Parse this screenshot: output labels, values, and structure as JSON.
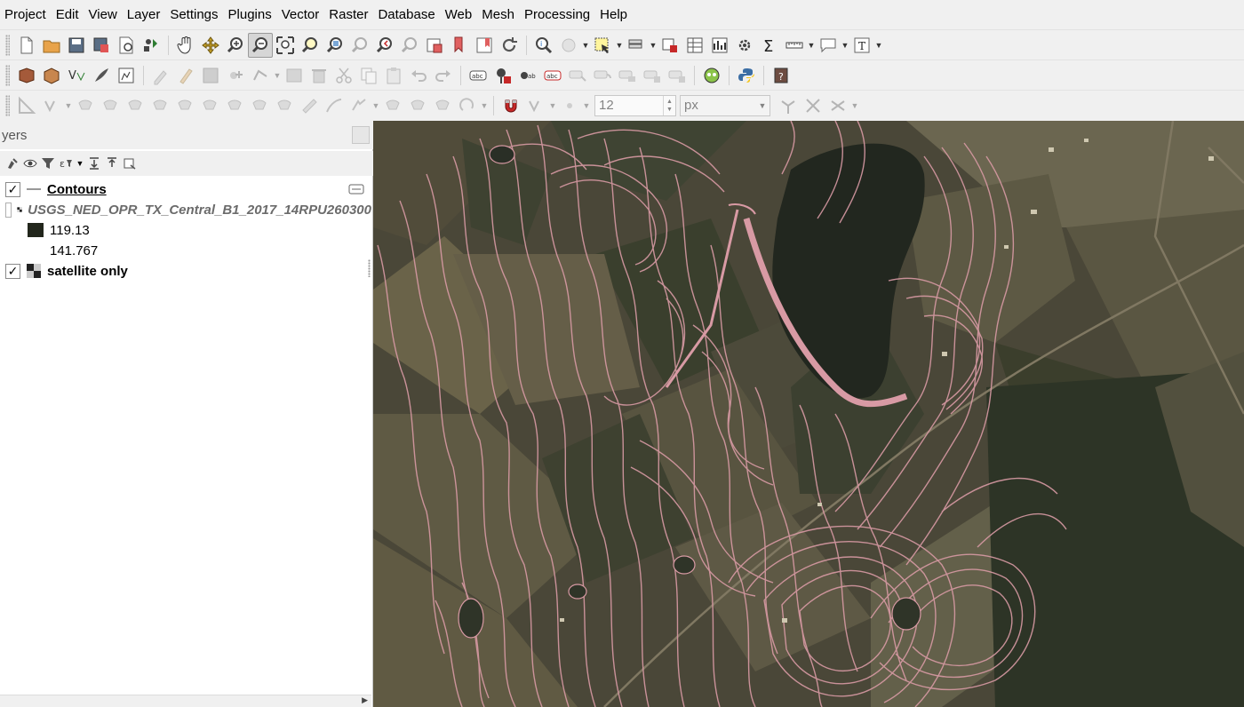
{
  "menu": {
    "items": [
      {
        "label": "Project",
        "name": "menu-project"
      },
      {
        "label": "Edit",
        "name": "menu-edit"
      },
      {
        "label": "View",
        "name": "menu-view"
      },
      {
        "label": "Layer",
        "name": "menu-layer"
      },
      {
        "label": "Settings",
        "name": "menu-settings"
      },
      {
        "label": "Plugins",
        "name": "menu-plugins"
      },
      {
        "label": "Vector",
        "name": "menu-vector"
      },
      {
        "label": "Raster",
        "name": "menu-raster"
      },
      {
        "label": "Database",
        "name": "menu-database"
      },
      {
        "label": "Web",
        "name": "menu-web"
      },
      {
        "label": "Mesh",
        "name": "menu-mesh"
      },
      {
        "label": "Processing",
        "name": "menu-processing"
      },
      {
        "label": "Help",
        "name": "menu-help"
      }
    ]
  },
  "snapping": {
    "tolerance_value": "12",
    "units_value": "px"
  },
  "layers_panel": {
    "title": "yers",
    "layers": [
      {
        "label": "Contours",
        "checked": true
      },
      {
        "label": "USGS_NED_OPR_TX_Central_B1_2017_14RPU260300",
        "checked": false
      },
      {
        "label": "satellite only",
        "checked": true
      }
    ],
    "legend": {
      "min": "119.13",
      "max": "141.767"
    }
  },
  "colors": {
    "contour": "#d89aa4",
    "toolbar_bg": "#f0f0f0",
    "map_bg": "#3c3a30"
  },
  "icons": {
    "toolbar1": [
      "new-project-icon",
      "open-project-icon",
      "save-project-icon",
      "save-as-icon",
      "print-layout-icon",
      "style-manager-icon",
      "pan-icon",
      "pan-to-selection-icon",
      "zoom-in-icon",
      "zoom-out-icon",
      "zoom-full-icon",
      "zoom-to-selection-icon",
      "zoom-to-layer-icon",
      "zoom-native-icon",
      "zoom-last-icon",
      "zoom-next-icon",
      "new-map-view-icon",
      "bookmark-icon",
      "show-bookmarks-icon",
      "refresh-icon",
      "identify-icon",
      "action-icon",
      "select-features-icon",
      "attribute-table-icon",
      "field-calculator-icon",
      "statistics-icon",
      "toolbox-icon",
      "sum-icon",
      "measure-icon",
      "annotation-icon",
      "text-annotation-icon"
    ],
    "toolbar2": [
      "data-source-manager-icon",
      "new-geopackage-icon",
      "new-shapefile-icon",
      "digitize-pen-icon",
      "edit-layer-icon",
      "current-edits-icon",
      "toggle-editing-icon",
      "save-edits-icon",
      "add-point-icon",
      "vertex-tool-icon",
      "delete-selected-icon",
      "cut-features-icon",
      "copy-features-icon",
      "paste-features-icon",
      "undo-icon",
      "redo-icon",
      "label-icon",
      "label-pin-icon",
      "label-highlight-icon",
      "label-show-hide-icon",
      "label-move-icon",
      "label-rotate-icon",
      "label-change-icon",
      "label-other-icon",
      "quickosm-icon",
      "python-console-icon",
      "plugin-icon"
    ],
    "toolbar3": [
      "digitize-angle-icon",
      "vertex-add-icon",
      "move-feature-icon",
      "rotate-feature-icon",
      "simplify-icon",
      "add-ring-icon",
      "add-part-icon",
      "fill-ring-icon",
      "delete-ring-icon",
      "delete-part-icon",
      "reshape-icon",
      "offset-curve-icon",
      "split-features-icon",
      "split-parts-icon",
      "merge-features-icon",
      "merge-attributes-icon",
      "rotate-point-icon",
      "snapping-magnet-icon",
      "snapping-mode-icon",
      "tolerance-spin-icon"
    ]
  }
}
